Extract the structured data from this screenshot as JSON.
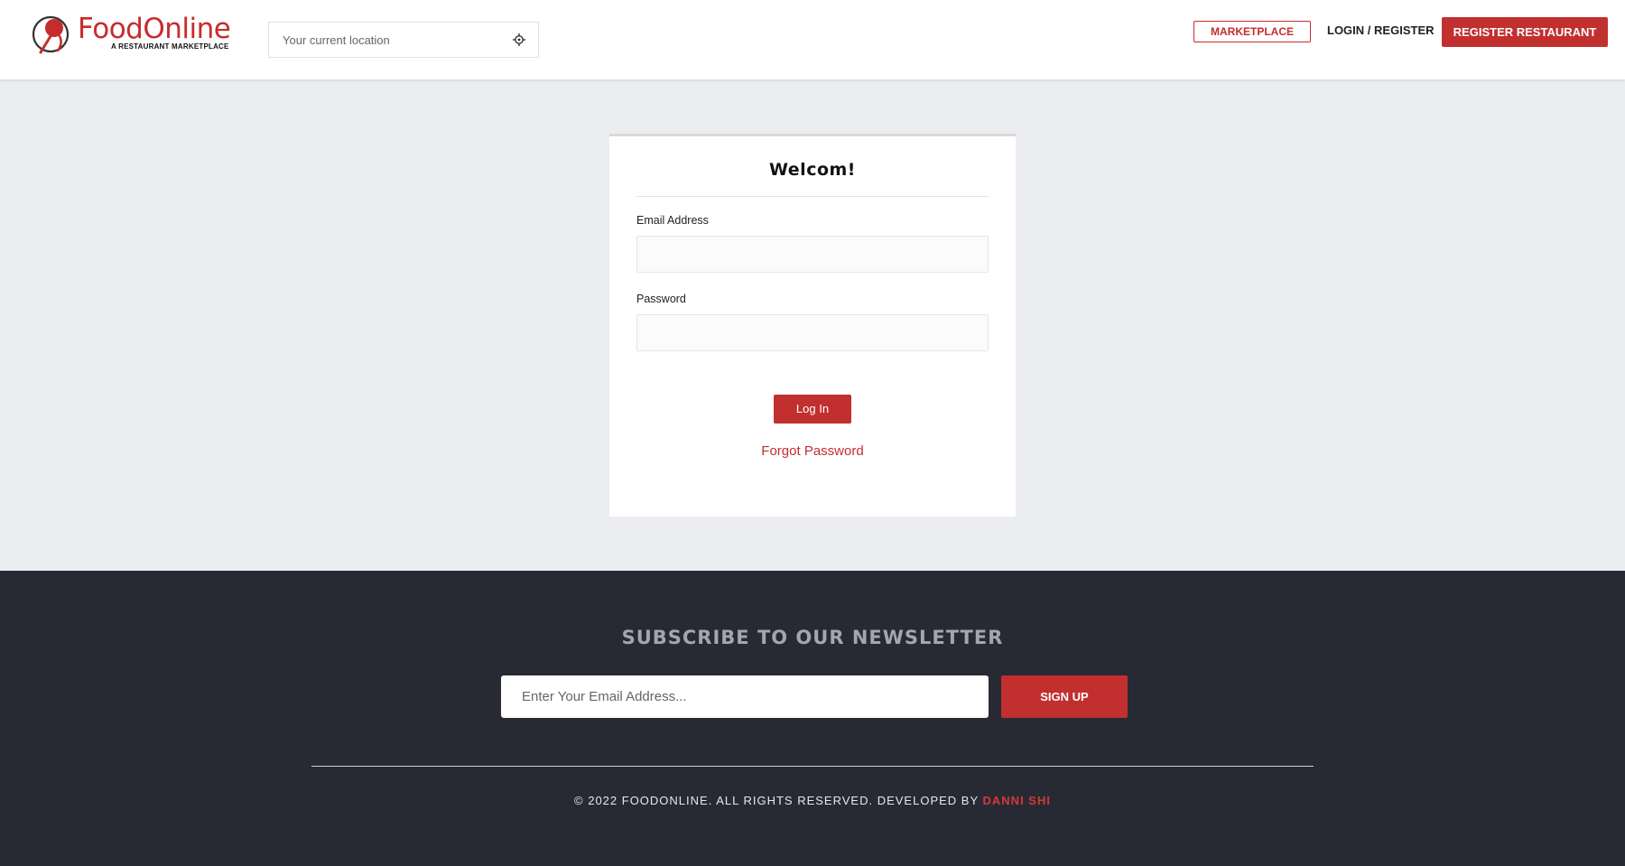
{
  "brand": {
    "name": "FoodOnline",
    "tagline": "A RESTAURANT MARKETPLACE",
    "accent_color": "#c22f2f"
  },
  "header": {
    "location_placeholder": "Your current location",
    "location_icon": "crosshair-icon",
    "marketplace_label": "MARKETPLACE",
    "login_label": "LOGIN",
    "separator": "/",
    "register_label": "REGISTER",
    "register_restaurant_label": "REGISTER RESTAURANT"
  },
  "login": {
    "title": "Welcom!",
    "email_label": "Email Address",
    "email_value": "",
    "password_label": "Password",
    "password_value": "",
    "submit_label": "Log In",
    "forgot_label": "Forgot Password"
  },
  "footer": {
    "newsletter_title": "SUBSCRIBE TO OUR NEWSLETTER",
    "newsletter_placeholder": "Enter Your Email Address...",
    "signup_label": "SIGN UP",
    "copyright_text": "© 2022 FOODONLINE. ALL RIGHTS RESERVED. DEVELOPED BY ",
    "developer_name": "DANNI SHI"
  }
}
